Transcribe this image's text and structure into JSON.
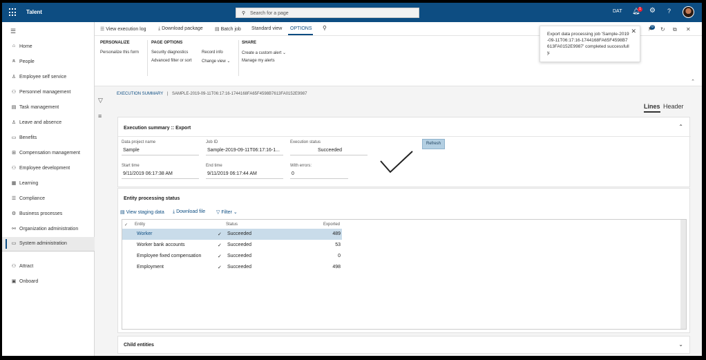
{
  "topbar": {
    "app_title": "Talent",
    "search_placeholder": "Search for a page",
    "company": "DAT",
    "notification_count": "1",
    "help": "?"
  },
  "sidebar": {
    "items": [
      {
        "label": "Home",
        "icon": "home-icon",
        "glyph": "⌂"
      },
      {
        "label": "People",
        "icon": "people-icon",
        "glyph": "ጸ"
      },
      {
        "label": "Employee self service",
        "icon": "person-icon",
        "glyph": "♙"
      },
      {
        "label": "Personnel management",
        "icon": "people-group-icon",
        "glyph": "⚇"
      },
      {
        "label": "Task management",
        "icon": "clipboard-icon",
        "glyph": "▤"
      },
      {
        "label": "Leave and absence",
        "icon": "person-leave-icon",
        "glyph": "♙"
      },
      {
        "label": "Benefits",
        "icon": "benefits-icon",
        "glyph": "▭"
      },
      {
        "label": "Compensation management",
        "icon": "compensation-icon",
        "glyph": "⊞"
      },
      {
        "label": "Employee development",
        "icon": "development-icon",
        "glyph": "⚇"
      },
      {
        "label": "Learning",
        "icon": "learning-icon",
        "glyph": "▦"
      },
      {
        "label": "Compliance",
        "icon": "compliance-icon",
        "glyph": "☰"
      },
      {
        "label": "Business processes",
        "icon": "process-icon",
        "glyph": "⚙"
      },
      {
        "label": "Organization administration",
        "icon": "org-icon",
        "glyph": "⚯"
      },
      {
        "label": "System administration",
        "icon": "system-admin-icon",
        "glyph": "▭"
      },
      {
        "label": "Attract",
        "icon": "attract-icon",
        "glyph": "⚇"
      },
      {
        "label": "Onboard",
        "icon": "onboard-icon",
        "glyph": "▣"
      }
    ],
    "active_index": 13
  },
  "actionbar": {
    "view_execution_log": "View execution log",
    "download_package": "Download package",
    "batch_job": "Batch job",
    "standard_view": "Standard view",
    "options": "OPTIONS"
  },
  "ribbon": {
    "personalize_title": "PERSONALIZE",
    "personalize_form": "Personalize this form",
    "page_options_title": "PAGE OPTIONS",
    "security_diagnostics": "Security diagnostics",
    "record_info": "Record info",
    "advanced_filter": "Advanced filter or sort",
    "change_view": "Change view ⌄",
    "share_title": "SHARE",
    "create_alert": "Create a custom alert ⌄",
    "manage_alerts": "Manage my alerts"
  },
  "toast": {
    "message": "Export data processing job 'Sample-2019-09-11T06:17:16-1744168FA65F4598B7613FA0152E9987' completed successfully.",
    "message_badge": "0"
  },
  "breadcrumb": {
    "section": "EXECUTION SUMMARY",
    "separator": "|",
    "job": "SAMPLE-2019-09-11T06:17:16-1744168FA65F4598B7613FA0152E9987"
  },
  "view_toggle": {
    "lines": "Lines",
    "header": "Header"
  },
  "summary": {
    "title": "Execution summary :: Export",
    "data_project_name_label": "Data project name",
    "data_project_name": "Sample",
    "job_id_label": "Job ID",
    "job_id": "Sample-2019-09-11T06:17:16-1...",
    "execution_status_label": "Execution status",
    "execution_status": "Succeeded",
    "start_time_label": "Start time",
    "start_time": "9/11/2019 06:17:38 AM",
    "end_time_label": "End time",
    "end_time": "9/11/2019 06:17:44 AM",
    "with_errors_label": "With errors:",
    "with_errors": "0",
    "refresh": "Refresh"
  },
  "entity_status": {
    "title": "Entity processing status",
    "view_staging": "View staging data",
    "download_file": "Download file",
    "filter": "Filter ⌄",
    "columns": {
      "entity": "Entity",
      "status": "Status",
      "exported": "Exported"
    },
    "rows": [
      {
        "entity": "Worker",
        "status": "Succeeded",
        "exported": "489"
      },
      {
        "entity": "Worker bank accounts",
        "status": "Succeeded",
        "exported": "53"
      },
      {
        "entity": "Employee fixed compensation",
        "status": "Succeeded",
        "exported": "0"
      },
      {
        "entity": "Employment",
        "status": "Succeeded",
        "exported": "498"
      }
    ]
  },
  "child_entities": {
    "title": "Child entities"
  },
  "colors": {
    "brand": "#0d4d82",
    "selected_row": "#c9dcea",
    "refresh_button": "#b3cfe2"
  }
}
